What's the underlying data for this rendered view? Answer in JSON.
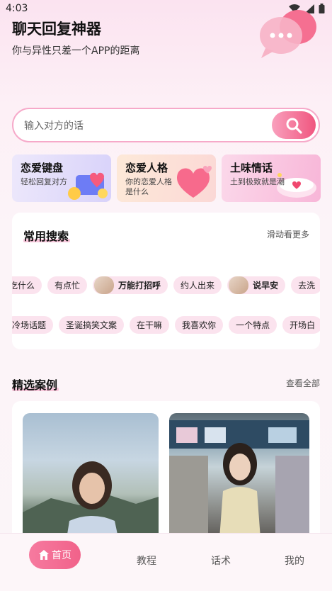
{
  "status": {
    "time": "4:03"
  },
  "header": {
    "title": "聊天回复神器",
    "subtitle": "你与异性只差一个APP的距离"
  },
  "search": {
    "placeholder": "输入对方的话"
  },
  "features": [
    {
      "title": "恋爱键盘",
      "desc": "轻松回复对方"
    },
    {
      "title": "恋爱人格",
      "desc": "你的恋爱人格是什么"
    },
    {
      "title": "土味情话",
      "desc": "土到极致就是潮"
    }
  ],
  "common": {
    "title": "常用搜索",
    "more": "滑动看更多",
    "row1": [
      "吃什么",
      "有点忙",
      "万能打招呼",
      "约人出来",
      "说早安",
      "去洗"
    ],
    "row2": [
      "冷场话题",
      "圣诞搞笑文案",
      "在干嘛",
      "我喜欢你",
      "一个特点",
      "开场白"
    ]
  },
  "cases": {
    "title": "精选案例",
    "more": "查看全部"
  },
  "nav": {
    "home": "首页",
    "tutorial": "教程",
    "script": "话术",
    "mine": "我的"
  },
  "colors": {
    "accent": "#f0567f",
    "tag_bg": "#fbe3ee",
    "underline": "#f9c7dc"
  }
}
